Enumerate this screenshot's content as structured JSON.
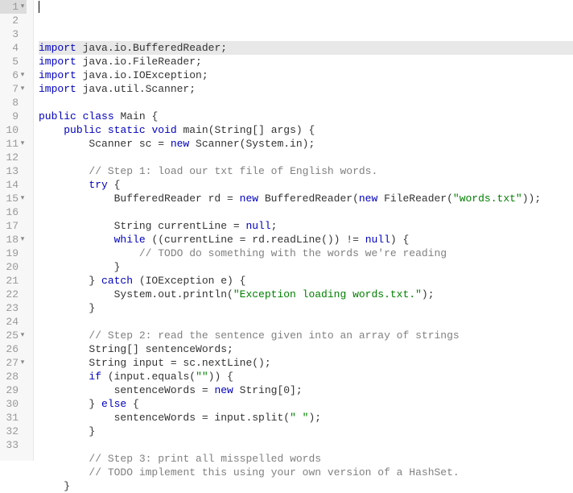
{
  "active_line": 1,
  "lines": [
    {
      "num": 1,
      "fold": true,
      "tokens": [
        [
          "kw",
          "import"
        ],
        [
          "",
          " java.io.BufferedReader;"
        ]
      ]
    },
    {
      "num": 2,
      "fold": false,
      "tokens": [
        [
          "kw",
          "import"
        ],
        [
          "",
          " java.io.FileReader;"
        ]
      ]
    },
    {
      "num": 3,
      "fold": false,
      "tokens": [
        [
          "kw",
          "import"
        ],
        [
          "",
          " java.io.IOException;"
        ]
      ]
    },
    {
      "num": 4,
      "fold": false,
      "tokens": [
        [
          "kw",
          "import"
        ],
        [
          "",
          " java.util.Scanner;"
        ]
      ]
    },
    {
      "num": 5,
      "fold": false,
      "tokens": []
    },
    {
      "num": 6,
      "fold": true,
      "tokens": [
        [
          "kw",
          "public"
        ],
        [
          "",
          " "
        ],
        [
          "kw",
          "class"
        ],
        [
          "",
          " Main {"
        ]
      ]
    },
    {
      "num": 7,
      "fold": true,
      "tokens": [
        [
          "",
          "    "
        ],
        [
          "kw",
          "public"
        ],
        [
          "",
          " "
        ],
        [
          "kw",
          "static"
        ],
        [
          "",
          " "
        ],
        [
          "kw",
          "void"
        ],
        [
          "",
          " main(String[] args) {"
        ]
      ]
    },
    {
      "num": 8,
      "fold": false,
      "tokens": [
        [
          "",
          "        Scanner sc = "
        ],
        [
          "kw",
          "new"
        ],
        [
          "",
          " Scanner(System.in);"
        ]
      ]
    },
    {
      "num": 9,
      "fold": false,
      "tokens": []
    },
    {
      "num": 10,
      "fold": false,
      "tokens": [
        [
          "",
          "        "
        ],
        [
          "com",
          "// Step 1: load our txt file of English words."
        ]
      ]
    },
    {
      "num": 11,
      "fold": true,
      "tokens": [
        [
          "",
          "        "
        ],
        [
          "kw",
          "try"
        ],
        [
          "",
          " {"
        ]
      ]
    },
    {
      "num": 12,
      "fold": false,
      "tokens": [
        [
          "",
          "            BufferedReader rd = "
        ],
        [
          "kw",
          "new"
        ],
        [
          "",
          " BufferedReader("
        ],
        [
          "kw",
          "new"
        ],
        [
          "",
          " FileReader("
        ],
        [
          "str",
          "\"words.txt\""
        ],
        [
          "",
          "));"
        ]
      ]
    },
    {
      "num": 13,
      "fold": false,
      "tokens": []
    },
    {
      "num": 14,
      "fold": false,
      "tokens": [
        [
          "",
          "            String currentLine = "
        ],
        [
          "kw",
          "null"
        ],
        [
          "",
          ";"
        ]
      ]
    },
    {
      "num": 15,
      "fold": true,
      "tokens": [
        [
          "",
          "            "
        ],
        [
          "kw",
          "while"
        ],
        [
          "",
          " ((currentLine = rd.readLine()) != "
        ],
        [
          "kw",
          "null"
        ],
        [
          "",
          ") {"
        ]
      ]
    },
    {
      "num": 16,
      "fold": false,
      "tokens": [
        [
          "",
          "                "
        ],
        [
          "com",
          "// TODO do something with the words we're reading"
        ]
      ]
    },
    {
      "num": 17,
      "fold": false,
      "tokens": [
        [
          "",
          "            }"
        ]
      ]
    },
    {
      "num": 18,
      "fold": true,
      "tokens": [
        [
          "",
          "        } "
        ],
        [
          "kw",
          "catch"
        ],
        [
          "",
          " (IOException e) {"
        ]
      ]
    },
    {
      "num": 19,
      "fold": false,
      "tokens": [
        [
          "",
          "            System.out.println("
        ],
        [
          "str",
          "\"Exception loading words.txt.\""
        ],
        [
          "",
          ");"
        ]
      ]
    },
    {
      "num": 20,
      "fold": false,
      "tokens": [
        [
          "",
          "        }"
        ]
      ]
    },
    {
      "num": 21,
      "fold": false,
      "tokens": []
    },
    {
      "num": 22,
      "fold": false,
      "tokens": [
        [
          "",
          "        "
        ],
        [
          "com",
          "// Step 2: read the sentence given into an array of strings"
        ]
      ]
    },
    {
      "num": 23,
      "fold": false,
      "tokens": [
        [
          "",
          "        String[] sentenceWords;"
        ]
      ]
    },
    {
      "num": 24,
      "fold": false,
      "tokens": [
        [
          "",
          "        String input = sc.nextLine();"
        ]
      ]
    },
    {
      "num": 25,
      "fold": true,
      "tokens": [
        [
          "",
          "        "
        ],
        [
          "kw",
          "if"
        ],
        [
          "",
          " (input.equals("
        ],
        [
          "str",
          "\"\""
        ],
        [
          "",
          ")) {"
        ]
      ]
    },
    {
      "num": 26,
      "fold": false,
      "tokens": [
        [
          "",
          "            sentenceWords = "
        ],
        [
          "kw",
          "new"
        ],
        [
          "",
          " String[0];"
        ]
      ]
    },
    {
      "num": 27,
      "fold": true,
      "tokens": [
        [
          "",
          "        } "
        ],
        [
          "kw",
          "else"
        ],
        [
          "",
          " {"
        ]
      ]
    },
    {
      "num": 28,
      "fold": false,
      "tokens": [
        [
          "",
          "            sentenceWords = input.split("
        ],
        [
          "str",
          "\" \""
        ],
        [
          "",
          ");"
        ]
      ]
    },
    {
      "num": 29,
      "fold": false,
      "tokens": [
        [
          "",
          "        }"
        ]
      ]
    },
    {
      "num": 30,
      "fold": false,
      "tokens": []
    },
    {
      "num": 31,
      "fold": false,
      "tokens": [
        [
          "",
          "        "
        ],
        [
          "com",
          "// Step 3: print all misspelled words"
        ]
      ]
    },
    {
      "num": 32,
      "fold": false,
      "tokens": [
        [
          "",
          "        "
        ],
        [
          "com",
          "// TODO implement this using your own version of a HashSet."
        ]
      ]
    },
    {
      "num": 33,
      "fold": false,
      "tokens": [
        [
          "",
          "    }"
        ]
      ]
    }
  ]
}
